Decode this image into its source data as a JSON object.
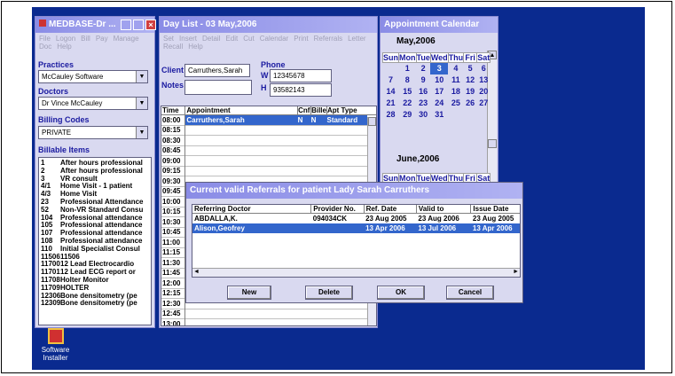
{
  "medbase": {
    "title": "MEDBASE-Dr ...",
    "menu": [
      "File",
      "Logon",
      "Bill",
      "Pay",
      "Manage"
    ],
    "menu2": [
      "Doc",
      "Help"
    ],
    "practices_label": "Practices",
    "practice_value": "McCauley Software",
    "doctors_label": "Doctors",
    "doctor_value": "Dr Vince McCauley",
    "billing_label": "Billing Codes",
    "billing_value": "PRIVATE",
    "billable_label": "Billable Items",
    "items": [
      [
        "1",
        "After hours professional"
      ],
      [
        "2",
        "After hours professional"
      ],
      [
        "3",
        "VR consult"
      ],
      [
        "4/1",
        "Home Visit - 1 patient"
      ],
      [
        "4/3",
        "Home Visit"
      ],
      [
        "23",
        "Professional Attendance"
      ],
      [
        "52",
        "Non-VR Standard Consu"
      ],
      [
        "104",
        "Professional attendance"
      ],
      [
        "105",
        "Professional attendance"
      ],
      [
        "107",
        "Professional attendance"
      ],
      [
        "108",
        "Professional attendance"
      ],
      [
        "110",
        "Initial Specialist Consul"
      ],
      [
        "11506",
        "11506"
      ],
      [
        "11700",
        "12 Lead Electrocardio"
      ],
      [
        "11701",
        "12 Lead ECG report or"
      ],
      [
        "11708",
        "Holter Monitor"
      ],
      [
        "11709",
        "HOLTER"
      ],
      [
        "12306",
        "Bone densitometry (pe"
      ],
      [
        "12309",
        "Bone densitometry (pe"
      ]
    ]
  },
  "daylist": {
    "title": "Day List - 03 May,2006",
    "menu": [
      "Set",
      "Insert",
      "Detail",
      "Edit",
      "Cut",
      "Calendar",
      "Print",
      "Referrals",
      "Letter"
    ],
    "menu2": [
      "Recall",
      "Help"
    ],
    "client_label": "Client",
    "client_value": "Carruthers,Sarah",
    "notes_label": "Notes",
    "notes_value": "",
    "phone_label": "Phone",
    "w_label": "W",
    "w_value": "12345678",
    "h_label": "H",
    "h_value": "93582143",
    "headers": [
      "Time",
      "Appointment",
      "Cnf",
      "Bille",
      "Apt Type"
    ],
    "times": [
      "08:00",
      "08:15",
      "08:30",
      "08:45",
      "09:00",
      "09:15",
      "09:30",
      "09:45",
      "10:00",
      "10:15",
      "10:30",
      "10:45",
      "11:00",
      "11:15",
      "11:30",
      "11:45",
      "12:00",
      "12:15",
      "12:30",
      "12:45",
      "13:00"
    ],
    "first_row": {
      "appointment": "Carruthers,Sarah",
      "cnf": "N",
      "bille": "N",
      "type": "Standard"
    }
  },
  "calendar": {
    "title": "Appointment Calendar",
    "month1": "May,2006",
    "days": [
      "Sun",
      "Mon",
      "Tue",
      "Wed",
      "Thu",
      "Fri",
      "Sat"
    ],
    "weeks": [
      [
        "",
        "1",
        "2",
        "3",
        "4",
        "5",
        "6"
      ],
      [
        "7",
        "8",
        "9",
        "10",
        "11",
        "12",
        "13"
      ],
      [
        "14",
        "15",
        "16",
        "17",
        "18",
        "19",
        "20"
      ],
      [
        "21",
        "22",
        "23",
        "24",
        "25",
        "26",
        "27"
      ],
      [
        "28",
        "29",
        "30",
        "31",
        "",
        "",
        ""
      ]
    ],
    "selected": "3",
    "month2": "June,2006"
  },
  "referrals": {
    "title": "Current valid Referrals for patient Lady Sarah Carruthers",
    "headers": [
      "Referring Doctor",
      "Provider No.",
      "Ref. Date",
      "Valid to",
      "Issue Date"
    ],
    "rows": [
      [
        "ABDALLA,K.",
        "094034CK",
        "23 Aug 2005",
        "23 Aug 2006",
        "23 Aug 2005"
      ],
      [
        "Alison,Geofrey",
        "",
        "13 Apr 2006",
        "13 Jul 2006",
        "13 Apr 2006"
      ]
    ],
    "buttons": [
      "New",
      "Delete",
      "OK",
      "Cancel"
    ]
  },
  "desktop": {
    "icon_label1": "Software",
    "icon_label2": "Installer"
  },
  "colors": {
    "desktop": "#0a2a8f",
    "selection": "#3366cc",
    "title": "#8a8ce6"
  }
}
